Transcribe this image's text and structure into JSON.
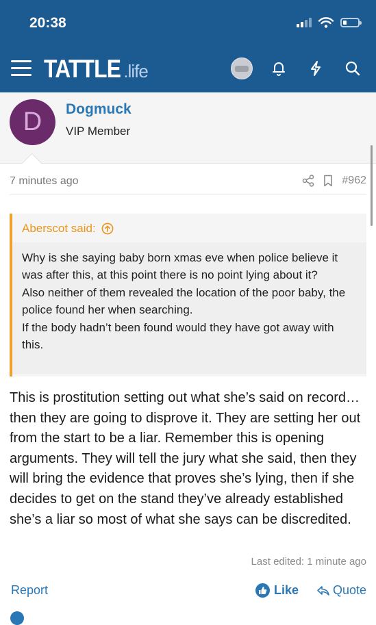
{
  "status": {
    "time": "20:38"
  },
  "header": {
    "logo_main": "TATTLE",
    "logo_suffix": ".life",
    "icons": [
      "menu-icon",
      "avatar",
      "bell-icon",
      "lightning-icon",
      "search-icon"
    ]
  },
  "colors": {
    "header_bg": "#1c5a92",
    "accent": "#2a77b5",
    "quote_accent": "#f0a030",
    "avatar_bg": "#6b2b6b"
  },
  "post": {
    "author": {
      "initial": "D",
      "name": "Dogmuck",
      "title": "VIP Member"
    },
    "time": "7 minutes ago",
    "number": "#962",
    "quote": {
      "author": "Aberscot said:",
      "text": "Why is she saying baby born xmas eve when police believe it was after this, at this point there is no point lying about it?\nAlso neither of them revealed the location of the poor baby, the police found her when searching.\nIf the body hadn’t been found would they have got away with this."
    },
    "body": "This is prostitution setting out what she’s said on record…then they are going to disprove it. They are setting her out from the start to be a liar. Remember this is opening arguments. They will tell the jury what she said, then they will bring the evidence that proves she’s lying, then if she decides to get on the stand they’ve already established she’s a liar so most of what she says can be discredited.",
    "edited": "Last edited: 1 minute ago",
    "actions": {
      "report": "Report",
      "like": "Like",
      "quote": "Quote"
    }
  }
}
